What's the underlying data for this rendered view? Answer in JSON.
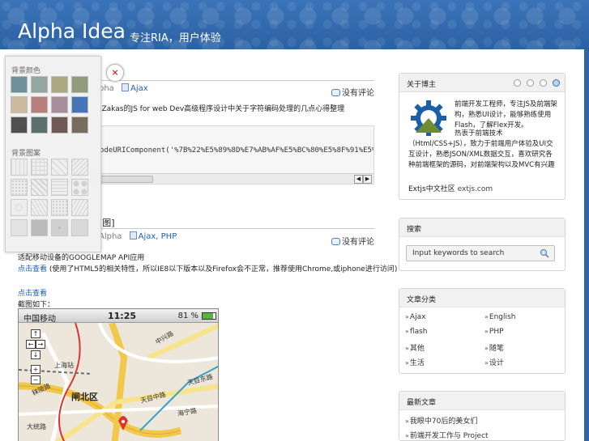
{
  "header": {
    "logo": "Alpha Idea",
    "slogan": "专注RIA，用户体验"
  },
  "post1": {
    "author_tail": "pha",
    "category": "Ajax",
    "comments": "没有评论",
    "intro": "]Zakas的JS for web Dev高级程序设计中关于字符编码处理的几点心得整理",
    "code": "odeURIComponent('%7B%22%E5%89%8D%E7%AB%AF%E5%BC%80%E5%8F%91%E5%B7%A5",
    "scroll_left": "◀",
    "scroll_right": "▶"
  },
  "post2": {
    "title_tail": "[图]",
    "author_tail": "Alpha",
    "categories": "Ajax, PHP",
    "comments": "没有评论",
    "line1": "适配移动设备的GOOGLEMAP API应用",
    "line2_link": "点击查看",
    "line2_rest": " (使用了HTML5的相关特性，所以IE8以下版本以及Firefox会不正常，推荐使用Chrome,或iphone进行访问)",
    "link2": "点击查看",
    "caption": "截图如下："
  },
  "phone": {
    "carrier": "中国移动",
    "time": "11:25",
    "battery": "81 %",
    "district": "闸北区",
    "streets": [
      "上海站",
      "中兴路",
      "天目东路",
      "天目中路",
      "海宁路",
      "秣陵路",
      "大统路"
    ],
    "zoom_in": "+",
    "zoom_out": "−"
  },
  "sidebar": {
    "about": {
      "title": "关于博主",
      "p1": "前端开发工程师，专注JS及前端架构，熟悉UI设计，能够熟练使用Flash，了解Flex开发。",
      "p2": "热衷于前端技术（Html/CSS+JS），致力于前端用户体验及UI交互设计，熟悉JSON/XML数据交互，喜欢研究各种前端框架的源码，对前端架构以及MVC有兴趣",
      "p3_label": "Extjs中文社区",
      "p3_link": "extjs.com",
      "dot_labels": [
        "»",
        "»",
        "»",
        "»"
      ]
    },
    "search": {
      "title": "搜索",
      "placeholder": "Input keywords to search"
    },
    "categories": {
      "title": "文章分类",
      "items": [
        "Ajax",
        "English",
        "flash",
        "PHP",
        "其他",
        "随笔",
        "生活",
        "设计"
      ]
    },
    "recent": {
      "title": "最新文章",
      "items": [
        "我眼中70后的美女们",
        "前端开发工作与 Project"
      ]
    }
  },
  "palette": {
    "title_colors": "背景颜色",
    "title_patterns": "背景图案",
    "colors": [
      "#6a8e96",
      "#8fa39e",
      "#a9a67d",
      "#8c9978",
      "#c9b89a",
      "#b67b77",
      "#a38997",
      "#3e6fb5",
      "#4a4a4a",
      "#566b66",
      "#6b5251",
      "#716856"
    ],
    "close": "×"
  }
}
